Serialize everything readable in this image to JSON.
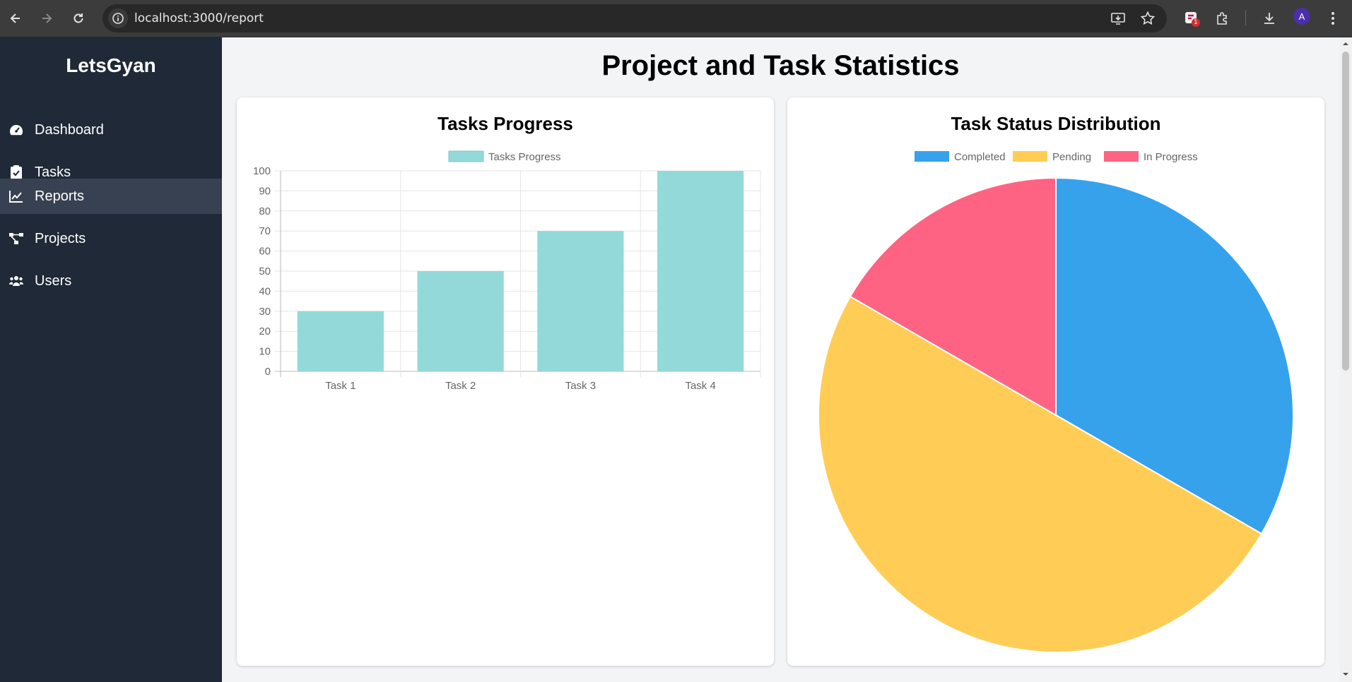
{
  "browser": {
    "url": "localhost:3000/report",
    "avatar_letter": "A",
    "extension_badge": "1",
    "icons": [
      "back-icon",
      "forward-icon",
      "reload-icon",
      "site-info-icon",
      "install-app-icon",
      "bookmark-star-icon",
      "extension-icon",
      "puzzle-icon",
      "download-icon",
      "menu-dots-icon"
    ]
  },
  "sidebar": {
    "brand": "LetsGyan",
    "items": [
      {
        "label": "Dashboard",
        "icon": "gauge-icon",
        "active": false
      },
      {
        "label": "Tasks",
        "icon": "clipboard-check-icon",
        "active": false
      },
      {
        "label": "Reports",
        "icon": "chart-line-icon",
        "active": true
      },
      {
        "label": "Projects",
        "icon": "project-diagram-icon",
        "active": false
      },
      {
        "label": "Users",
        "icon": "users-icon",
        "active": false
      }
    ]
  },
  "main": {
    "title": "Project and Task Statistics"
  },
  "colors": {
    "sidebar_bg": "#1f2937",
    "sidebar_active": "#374151",
    "bar_fill": "#94d9d9",
    "completed": "#36a2eb",
    "pending": "#ffcd56",
    "in_progress": "#ff6384"
  },
  "chart_data": [
    {
      "type": "bar",
      "title": "Tasks Progress",
      "categories": [
        "Task 1",
        "Task 2",
        "Task 3",
        "Task 4"
      ],
      "series": [
        {
          "name": "Tasks Progress",
          "values": [
            30,
            50,
            70,
            100
          ]
        }
      ],
      "ylim": [
        0,
        100
      ],
      "yticks": [
        0,
        10,
        20,
        30,
        40,
        50,
        60,
        70,
        80,
        90,
        100
      ],
      "grid": true,
      "legend": "top"
    },
    {
      "type": "pie",
      "title": "Task Status Distribution",
      "labels": [
        "Completed",
        "Pending",
        "In Progress"
      ],
      "values": [
        2,
        3,
        1
      ],
      "legend": "top"
    }
  ]
}
